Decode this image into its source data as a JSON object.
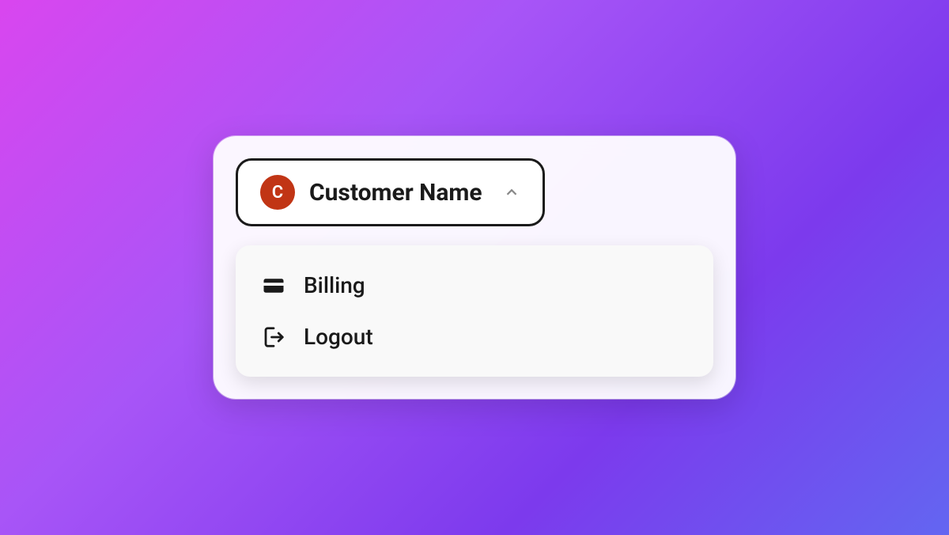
{
  "profile": {
    "avatar_initial": "C",
    "name": "Customer Name"
  },
  "menu": {
    "items": [
      {
        "icon": "credit-card",
        "label": "Billing"
      },
      {
        "icon": "logout",
        "label": "Logout"
      }
    ]
  }
}
